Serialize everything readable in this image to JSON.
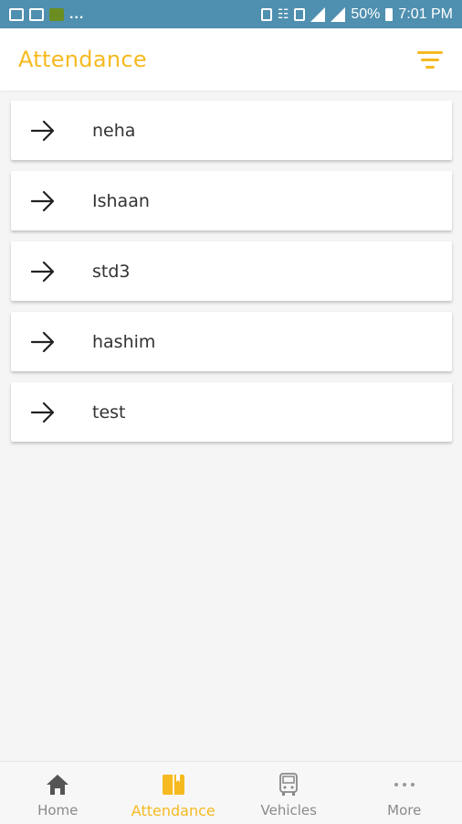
{
  "status_bar": {
    "battery": "50%",
    "time": "7:01 PM",
    "ellipsis": "..."
  },
  "app_bar": {
    "title": "Attendance"
  },
  "students": [
    {
      "name": "neha"
    },
    {
      "name": "Ishaan"
    },
    {
      "name": "std3"
    },
    {
      "name": "hashim"
    },
    {
      "name": "test"
    }
  ],
  "bottom_nav": {
    "items": [
      {
        "label": "Home",
        "icon": "home-icon"
      },
      {
        "label": "Attendance",
        "icon": "book-icon",
        "active": true
      },
      {
        "label": "Vehicles",
        "icon": "bus-icon"
      },
      {
        "label": "More",
        "icon": "more-dots-icon"
      }
    ]
  },
  "colors": {
    "accent": "#f6ba21",
    "status_bar": "#4f8fb0",
    "inactive": "#8a8a8a"
  }
}
